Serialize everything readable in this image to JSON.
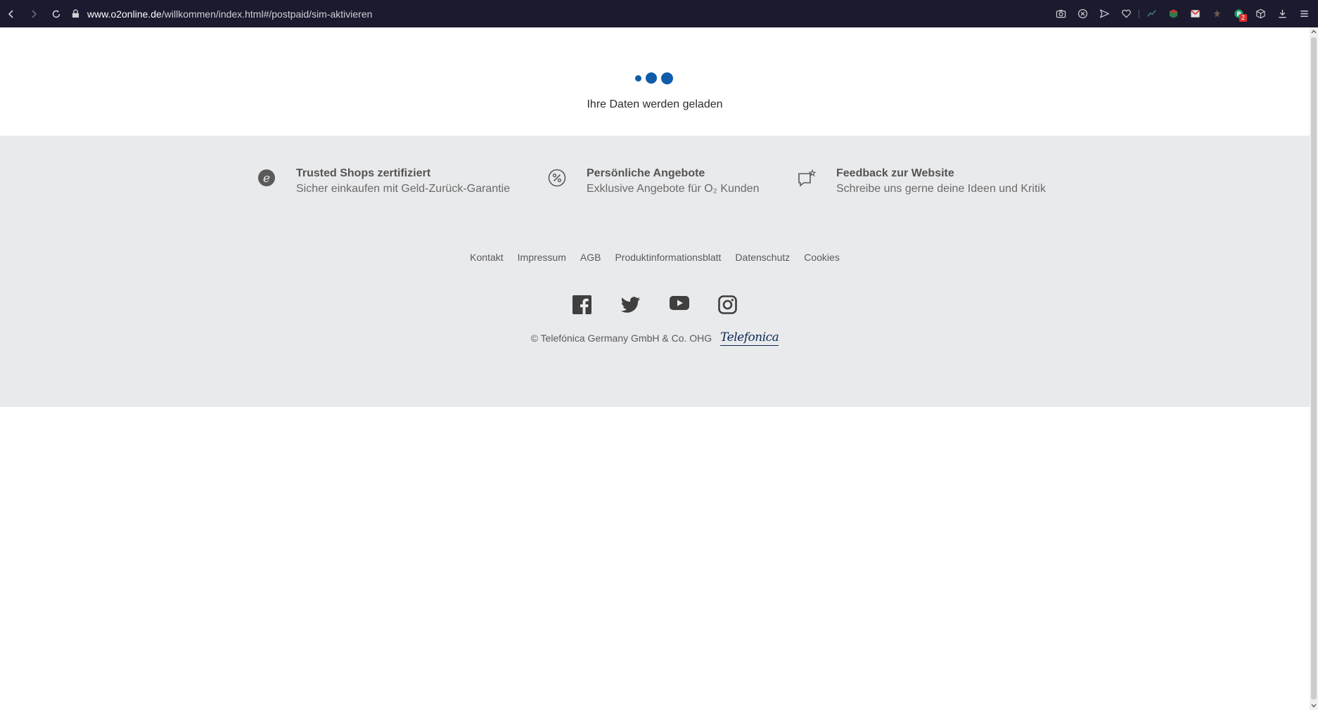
{
  "browser": {
    "url_domain": "www.o2online.de",
    "url_path": "/willkommen/index.html#/postpaid/sim-aktivieren",
    "extensions": [
      "camera-icon",
      "shield-x-icon",
      "send-icon",
      "heart-icon",
      "extension-icon",
      "extension-icon",
      "extension-icon",
      "extension-icon",
      "extension-icon",
      "cube-icon",
      "download-icon",
      "menu-icon"
    ],
    "badge_count": "2"
  },
  "loader": {
    "text": "Ihre Daten werden geladen",
    "color": "#0f5cab"
  },
  "features": [
    {
      "title": "Trusted Shops zertifiziert",
      "subtitle": "Sicher einkaufen mit Geld-Zurück-Garantie",
      "icon": "trusted-shops-icon"
    },
    {
      "title": "Persönliche Angebote",
      "subtitle": "Exklusive Angebote für O₂ Kunden",
      "icon": "percent-icon"
    },
    {
      "title": "Feedback zur Website",
      "subtitle": "Schreibe uns gerne deine Ideen und Kritik",
      "icon": "feedback-icon"
    }
  ],
  "footer_links": [
    "Kontakt",
    "Impressum",
    "AGB",
    "Produktinformationsblatt",
    "Datenschutz",
    "Cookies"
  ],
  "social": [
    "facebook-icon",
    "twitter-icon",
    "youtube-icon",
    "instagram-icon"
  ],
  "copyright": "© Telefónica Germany GmbH & Co. OHG",
  "logo_text": "Telefonica",
  "colors": {
    "chrome": "#1b1a2e",
    "footer_bg": "#e9eaec",
    "brand_blue": "#0f5cab"
  }
}
